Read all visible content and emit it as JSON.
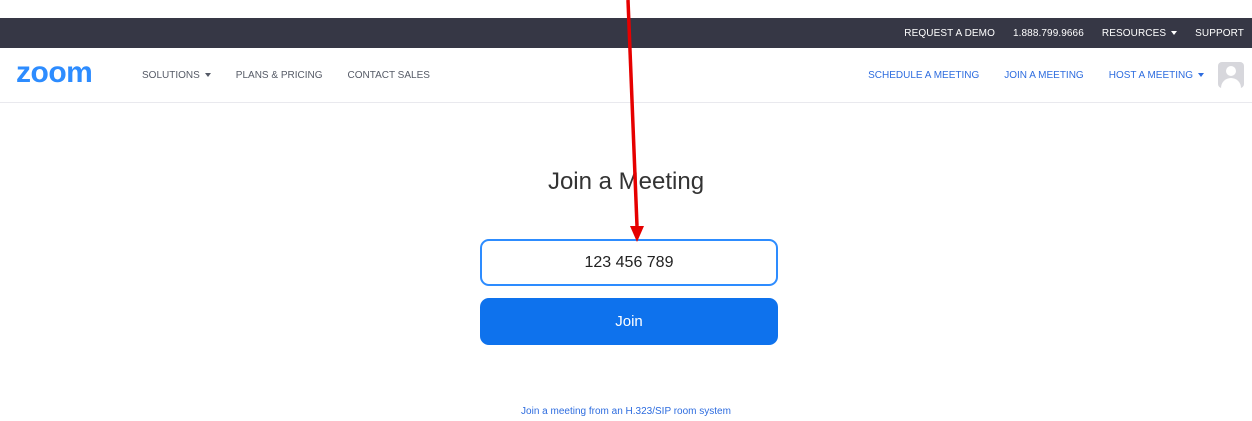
{
  "topbar": {
    "items": [
      {
        "label": "REQUEST A DEMO"
      },
      {
        "label": "1.888.799.9666"
      },
      {
        "label": "RESOURCES"
      },
      {
        "label": "SUPPORT"
      }
    ]
  },
  "navbar": {
    "logo": "zoom",
    "left": [
      {
        "label": "SOLUTIONS"
      },
      {
        "label": "PLANS & PRICING"
      },
      {
        "label": "CONTACT SALES"
      }
    ],
    "right": [
      {
        "label": "SCHEDULE A MEETING"
      },
      {
        "label": "JOIN A MEETING"
      },
      {
        "label": "HOST A MEETING"
      }
    ],
    "avatar_icon": "user-avatar-icon"
  },
  "main": {
    "title": "Join a Meeting",
    "meeting_id_value": "123 456 789",
    "join_label": "Join",
    "sip_link": "Join a meeting from an H.323/SIP room system"
  },
  "annotation": {
    "arrow_color": "#e60000"
  },
  "colors": {
    "brand": "#2d8cff",
    "topbar_bg": "#363745",
    "join_button": "#0e72ed"
  }
}
